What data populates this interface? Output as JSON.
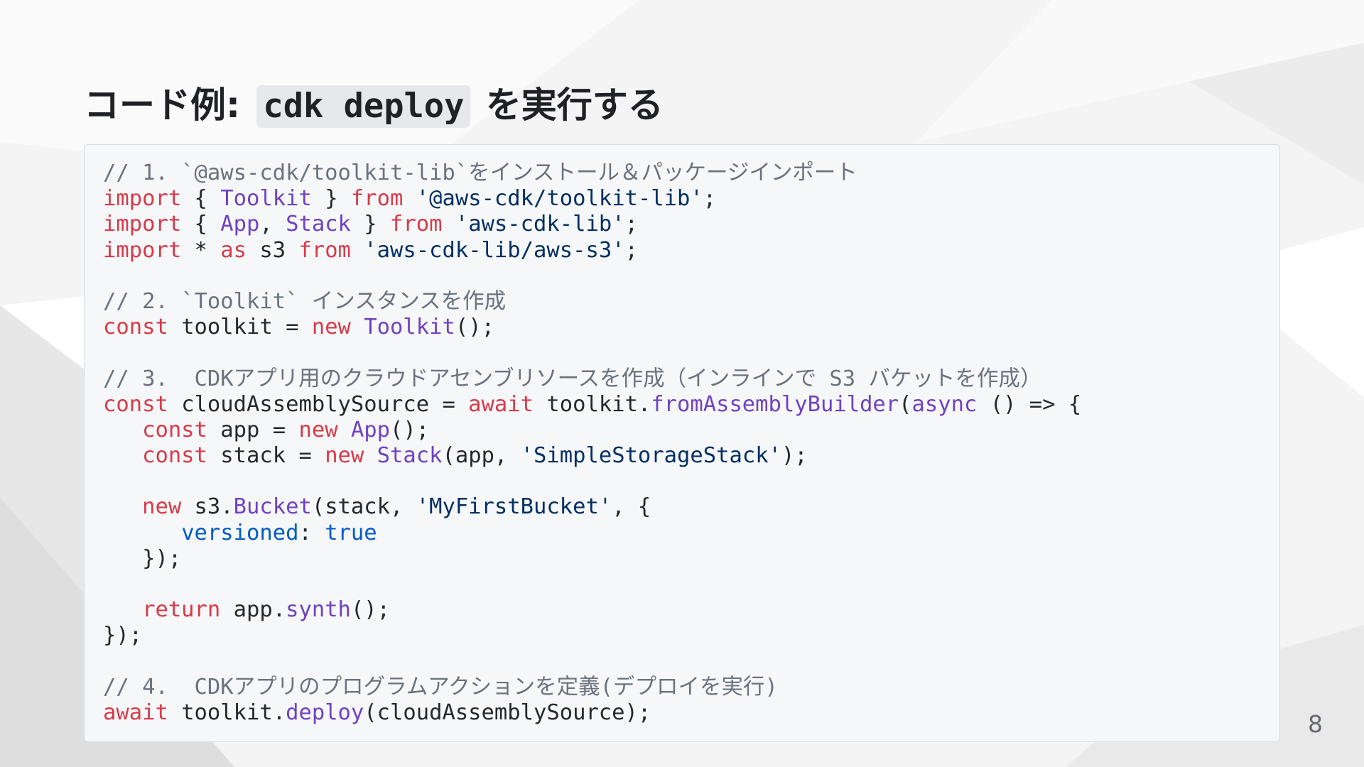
{
  "slide": {
    "title_prefix": "コード例:",
    "title_code": "cdk deploy",
    "title_suffix": "を実行する",
    "page_number": "8"
  },
  "colors": {
    "comment": "#6a737d",
    "keyword": "#d73a49",
    "class": "#6f42c1",
    "string": "#032f62",
    "property": "#005cc5",
    "plain": "#24292e"
  },
  "code_lines": [
    [
      {
        "t": "// 1. `@aws-cdk/toolkit-lib`をインストール＆パッケージインポート",
        "k": "comment"
      }
    ],
    [
      {
        "t": "import",
        "k": "keyword"
      },
      {
        "t": " { ",
        "k": "plain"
      },
      {
        "t": "Toolkit",
        "k": "class"
      },
      {
        "t": " } ",
        "k": "plain"
      },
      {
        "t": "from",
        "k": "keyword"
      },
      {
        "t": " ",
        "k": "plain"
      },
      {
        "t": "'@aws-cdk/toolkit-lib'",
        "k": "string"
      },
      {
        "t": ";",
        "k": "plain"
      }
    ],
    [
      {
        "t": "import",
        "k": "keyword"
      },
      {
        "t": " { ",
        "k": "plain"
      },
      {
        "t": "App",
        "k": "class"
      },
      {
        "t": ", ",
        "k": "plain"
      },
      {
        "t": "Stack",
        "k": "class"
      },
      {
        "t": " } ",
        "k": "plain"
      },
      {
        "t": "from",
        "k": "keyword"
      },
      {
        "t": " ",
        "k": "plain"
      },
      {
        "t": "'aws-cdk-lib'",
        "k": "string"
      },
      {
        "t": ";",
        "k": "plain"
      }
    ],
    [
      {
        "t": "import",
        "k": "keyword"
      },
      {
        "t": " * ",
        "k": "plain"
      },
      {
        "t": "as",
        "k": "keyword"
      },
      {
        "t": " s3 ",
        "k": "plain"
      },
      {
        "t": "from",
        "k": "keyword"
      },
      {
        "t": " ",
        "k": "plain"
      },
      {
        "t": "'aws-cdk-lib/aws-s3'",
        "k": "string"
      },
      {
        "t": ";",
        "k": "plain"
      }
    ],
    [],
    [
      {
        "t": "// 2. `Toolkit` インスタンスを作成",
        "k": "comment"
      }
    ],
    [
      {
        "t": "const",
        "k": "keyword"
      },
      {
        "t": " toolkit = ",
        "k": "plain"
      },
      {
        "t": "new",
        "k": "keyword"
      },
      {
        "t": " ",
        "k": "plain"
      },
      {
        "t": "Toolkit",
        "k": "class"
      },
      {
        "t": "();",
        "k": "plain"
      }
    ],
    [],
    [
      {
        "t": "// 3.  CDKアプリ用のクラウドアセンブリソースを作成（インラインで S3 バケットを作成）",
        "k": "comment"
      }
    ],
    [
      {
        "t": "const",
        "k": "keyword"
      },
      {
        "t": " cloudAssemblySource = ",
        "k": "plain"
      },
      {
        "t": "await",
        "k": "keyword"
      },
      {
        "t": " toolkit.",
        "k": "plain"
      },
      {
        "t": "fromAssemblyBuilder",
        "k": "class"
      },
      {
        "t": "(",
        "k": "plain"
      },
      {
        "t": "async",
        "k": "class"
      },
      {
        "t": " () => {",
        "k": "plain"
      }
    ],
    [
      {
        "t": "   ",
        "k": "plain"
      },
      {
        "t": "const",
        "k": "keyword"
      },
      {
        "t": " app = ",
        "k": "plain"
      },
      {
        "t": "new",
        "k": "keyword"
      },
      {
        "t": " ",
        "k": "plain"
      },
      {
        "t": "App",
        "k": "class"
      },
      {
        "t": "();",
        "k": "plain"
      }
    ],
    [
      {
        "t": "   ",
        "k": "plain"
      },
      {
        "t": "const",
        "k": "keyword"
      },
      {
        "t": " stack = ",
        "k": "plain"
      },
      {
        "t": "new",
        "k": "keyword"
      },
      {
        "t": " ",
        "k": "plain"
      },
      {
        "t": "Stack",
        "k": "class"
      },
      {
        "t": "(app, ",
        "k": "plain"
      },
      {
        "t": "'SimpleStorageStack'",
        "k": "string"
      },
      {
        "t": ");",
        "k": "plain"
      }
    ],
    [],
    [
      {
        "t": "   ",
        "k": "plain"
      },
      {
        "t": "new",
        "k": "keyword"
      },
      {
        "t": " s3.",
        "k": "plain"
      },
      {
        "t": "Bucket",
        "k": "class"
      },
      {
        "t": "(stack, ",
        "k": "plain"
      },
      {
        "t": "'MyFirstBucket'",
        "k": "string"
      },
      {
        "t": ", {",
        "k": "plain"
      }
    ],
    [
      {
        "t": "      ",
        "k": "plain"
      },
      {
        "t": "versioned",
        "k": "prop"
      },
      {
        "t": ": ",
        "k": "plain"
      },
      {
        "t": "true",
        "k": "prop"
      }
    ],
    [
      {
        "t": "   });",
        "k": "plain"
      }
    ],
    [],
    [
      {
        "t": "   ",
        "k": "plain"
      },
      {
        "t": "return",
        "k": "keyword"
      },
      {
        "t": " app.",
        "k": "plain"
      },
      {
        "t": "synth",
        "k": "class"
      },
      {
        "t": "();",
        "k": "plain"
      }
    ],
    [
      {
        "t": "});",
        "k": "plain"
      }
    ],
    [],
    [
      {
        "t": "// 4.  CDKアプリのプログラムアクションを定義(デプロイを実行)",
        "k": "comment"
      }
    ],
    [
      {
        "t": "await",
        "k": "keyword"
      },
      {
        "t": " toolkit.",
        "k": "plain"
      },
      {
        "t": "deploy",
        "k": "class"
      },
      {
        "t": "(cloudAssemblySource);",
        "k": "plain"
      }
    ]
  ]
}
